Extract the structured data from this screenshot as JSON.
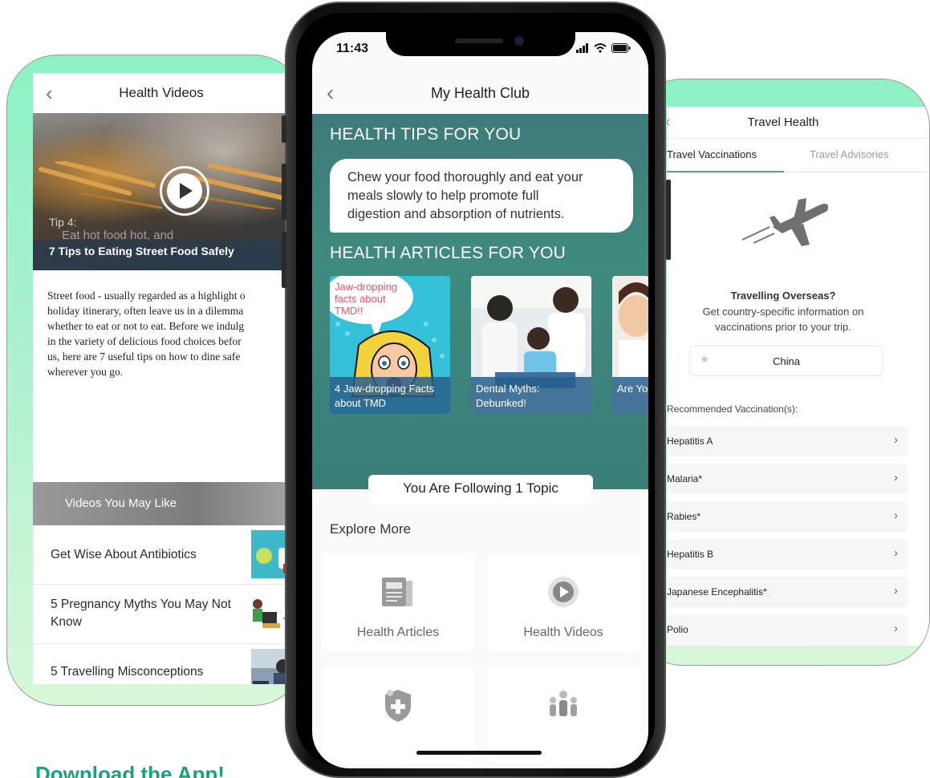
{
  "left_screen": {
    "title": "Health Videos",
    "video": {
      "tip_label": "Tip 4:",
      "tip_sub": "Eat hot food hot, and",
      "caption": "7 Tips to Eating Street Food Safely"
    },
    "article_lines": [
      "Street food - usually regarded as a highlight o",
      "holiday itinerary, often leave us in a dilemma",
      "whether to eat or not to eat. Before we indulg",
      "in the variety of delicious food choices befor",
      "us, here are 7 useful tips on how to dine safe",
      "wherever you go."
    ],
    "videos_you_may_like": "Videos You May Like",
    "video_list": [
      "Get Wise About Antibiotics",
      "5 Pregnancy Myths You May Not Know",
      "5 Travelling Misconceptions"
    ]
  },
  "phone": {
    "status_time": "11:43",
    "title": "My Health Club",
    "tips_heading": "HEALTH TIPS FOR YOU",
    "tip_text_lines": [
      "Chew your food thoroughly and eat your",
      "meals slowly to help promote full",
      "digestion and absorption of nutrients."
    ],
    "articles_heading": "HEALTH ARTICLES FOR YOU",
    "articles": [
      {
        "caption": "4 Jaw-dropping Facts about TMD",
        "overlay": "Jaw-dropping facts about TMD!!"
      },
      {
        "caption": "Dental Myths: Debunked!"
      },
      {
        "caption": "Are Yo... These..."
      }
    ],
    "follow_button": "You Are Following 1 Topic",
    "explore_more": "Explore More",
    "tiles": [
      {
        "label": "Health Articles",
        "icon": "article-icon"
      },
      {
        "label": "Health Videos",
        "icon": "play-icon"
      },
      {
        "label": "",
        "icon": "shield-plus-icon"
      },
      {
        "label": "",
        "icon": "community-icon"
      }
    ]
  },
  "right_screen": {
    "title": "Travel Health",
    "tabs": [
      "Travel Vaccinations",
      "Travel Advisories"
    ],
    "overseas_title": "Travelling Overseas?",
    "overseas_desc_lines": [
      "Get country-specific information on",
      "vaccinations prior to your trip."
    ],
    "country": "China",
    "recommended_label": "Recommended Vaccination(s):",
    "vaccinations": [
      "Hepatitis A",
      "Malaria*",
      "Rabies*",
      "Hepatitis B",
      "Japanese Encephalitis*",
      "Polio"
    ]
  },
  "cta": "Download the App!",
  "colors": {
    "teal": "#3f8b7f",
    "mint": "#8cf2c4",
    "cta_green": "#1aa17c"
  }
}
